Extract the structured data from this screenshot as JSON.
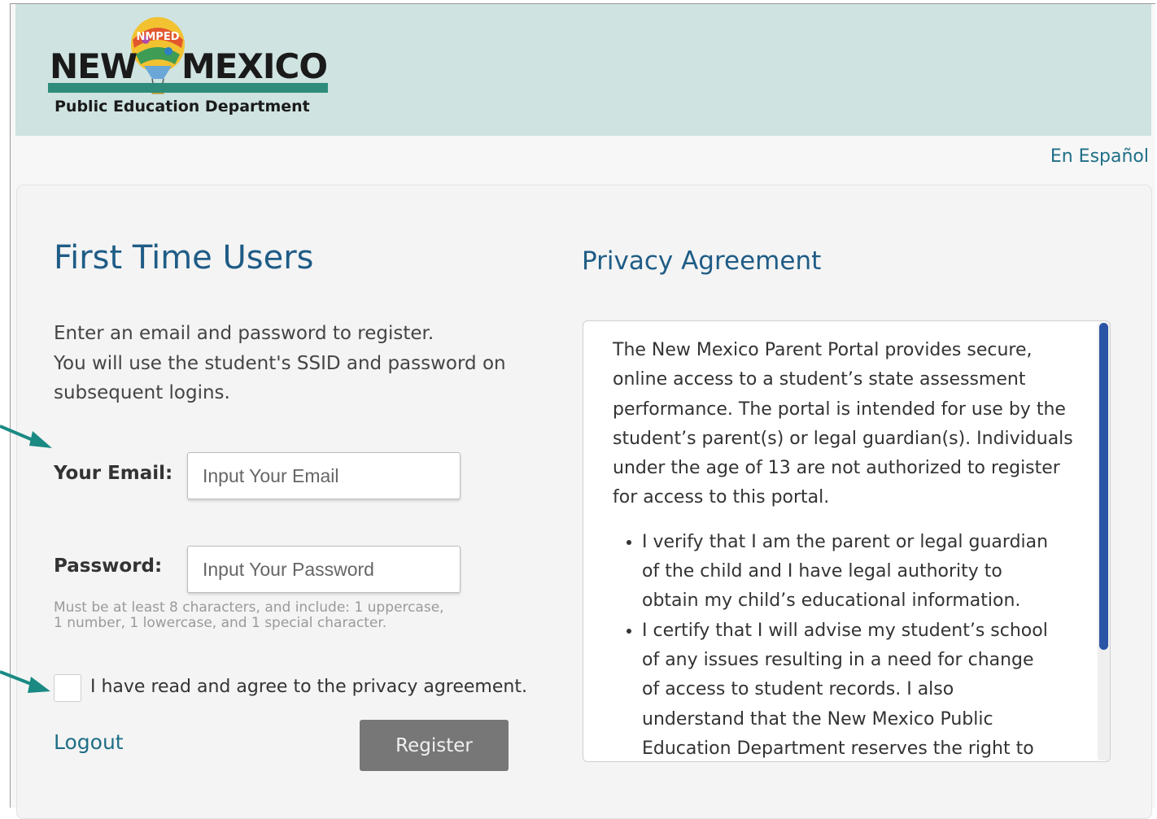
{
  "header": {
    "logo_word_left": "NEW",
    "logo_word_right": "MEXICO",
    "logo_badge": "NMPED",
    "logo_department": "Public Education Department"
  },
  "language_link": "En Español",
  "registration": {
    "title": "First Time Users",
    "intro_lines": [
      "Enter an email and password to register.",
      "You will use the student's SSID and password on",
      "subsequent logins."
    ],
    "email_label": "Your Email:",
    "email_placeholder": "Input Your Email",
    "password_label": "Password:",
    "password_placeholder": "Input Your Password",
    "password_hint_lines": [
      "Must be at least 8 characters, and include: 1 uppercase,",
      "1 number, 1 lowercase, and 1 special character."
    ],
    "agree_text": "I have read and agree to the privacy agreement.",
    "logout_label": "Logout",
    "register_label": "Register"
  },
  "privacy": {
    "title": "Privacy Agreement",
    "paragraph_lines": [
      "The New Mexico Parent Portal provides secure,",
      "online access to a student’s state assessment",
      "performance. The portal is intended for use by the",
      "student’s parent(s) or legal guardian(s). Individuals",
      "under the age of 13 are not authorized to register",
      "for access to this portal."
    ],
    "bullets": [
      [
        "I verify that I am the parent or legal guardian",
        "of the child and I have legal authority to",
        "obtain my child’s educational information."
      ],
      [
        "I certify that I will advise my student’s school",
        "of any issues resulting in a need for change",
        "of access to student records. I also",
        "understand that the New Mexico Public",
        "Education Department reserves the right to"
      ]
    ]
  },
  "colors": {
    "header_bg": "#cfe3e1",
    "accent_teal": "#2f8c7b",
    "title_blue": "#1f5c86",
    "link_blue": "#1f6f86",
    "scroll_thumb": "#2a55a6",
    "button_gray": "#777777",
    "annotation_arrow": "#1a8a83"
  }
}
